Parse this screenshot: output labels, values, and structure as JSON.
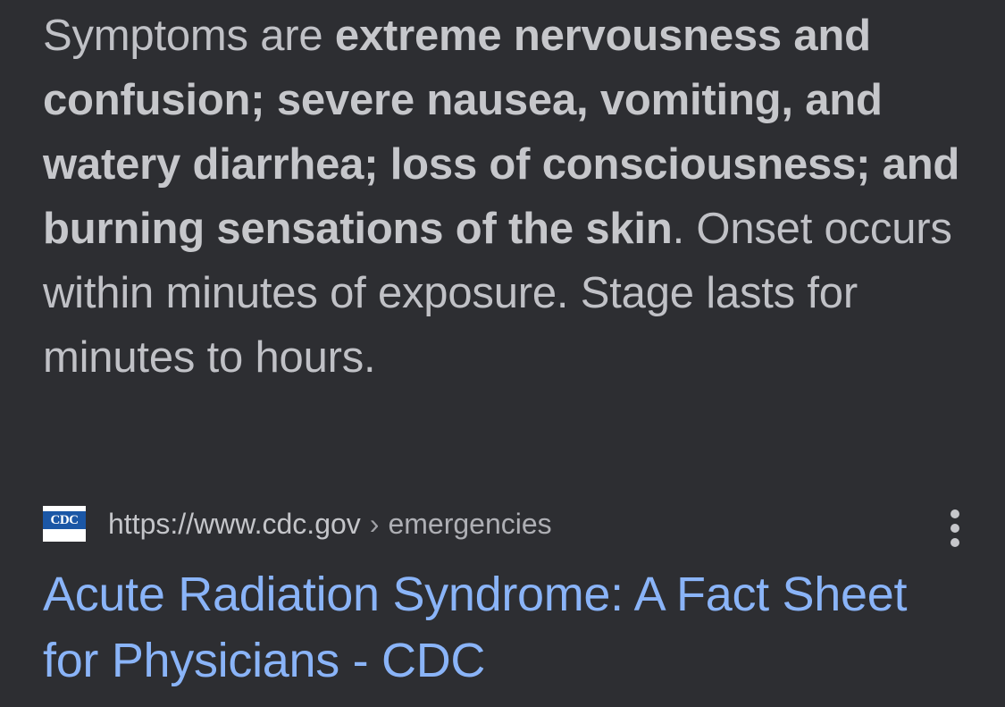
{
  "snippet": {
    "intro": "Symptoms are ",
    "bold": "extreme nervousness and confusion; severe nausea, vomiting, and watery diarrhea; loss of consciousness; and burning sensations of the skin",
    "rest": ". Onset occurs within minutes of exposure. Stage lasts for minutes to hours."
  },
  "result": {
    "favicon_text": "CDC",
    "favicon_icon": "cdc-logo-icon",
    "url_host": "https://www.cdc.gov",
    "url_separator": "›",
    "url_path": "emergencies",
    "more_icon": "more-vertical-icon",
    "title": "Acute Radiation Syndrome: A Fact Sheet for Physicians - CDC"
  },
  "colors": {
    "background": "#2d2e32",
    "body_text": "#c0c1c6",
    "link": "#8ab4f8",
    "cdc_blue": "#1b57a6"
  }
}
